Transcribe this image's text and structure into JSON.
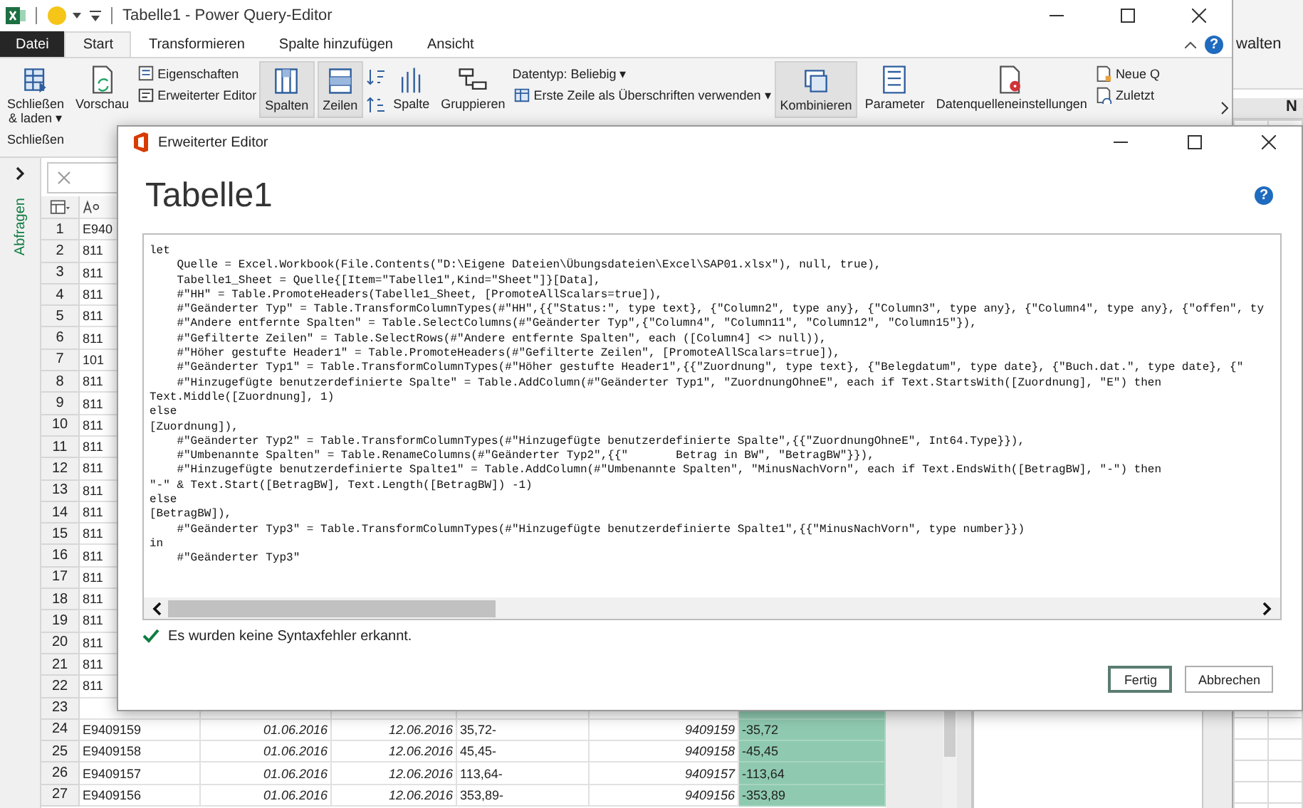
{
  "main_window": {
    "title": "Tabelle1 - Power Query-Editor"
  },
  "ribbon_tabs": [
    {
      "label": "Datei",
      "selected": false,
      "kind": "file"
    },
    {
      "label": "Start",
      "selected": true,
      "kind": "tab"
    },
    {
      "label": "Transformieren",
      "selected": false,
      "kind": "tab"
    },
    {
      "label": "Spalte hinzufügen",
      "selected": false,
      "kind": "tab"
    },
    {
      "label": "Ansicht",
      "selected": false,
      "kind": "tab"
    }
  ],
  "ribbon_help": "?",
  "ribbon": {
    "group_label": "Schließen",
    "items": [
      {
        "kind": "large",
        "lines": [
          "Schließen",
          "& laden ▾"
        ],
        "collapsed": false
      },
      {
        "kind": "large",
        "lines": [
          "Vorschau"
        ],
        "collapsed": false
      },
      {
        "kind": "stack",
        "entries": [
          "Eigenschaften",
          "Erweiterter Editor"
        ]
      },
      {
        "kind": "large",
        "lines": [
          "Spalten"
        ],
        "collapsed": true
      },
      {
        "kind": "large",
        "lines": [
          "Zeilen"
        ],
        "collapsed": true
      },
      {
        "kind": "sort"
      },
      {
        "kind": "large",
        "lines": [
          "Spalte"
        ],
        "collapsed": false
      },
      {
        "kind": "large",
        "lines": [
          "Gruppieren"
        ],
        "collapsed": false
      },
      {
        "kind": "stack",
        "entries": [
          "Datentyp: Beliebig ▾",
          "Erste Zeile als Überschriften verwenden ▾"
        ]
      },
      {
        "kind": "large",
        "lines": [
          "Kombinieren"
        ],
        "collapsed": true
      },
      {
        "kind": "large",
        "lines": [
          "Parameter"
        ],
        "collapsed": false
      },
      {
        "kind": "large",
        "lines": [
          "Datenquelleneinstellungen"
        ],
        "collapsed": false
      },
      {
        "kind": "stack",
        "entries": [
          "Neue Q",
          "Zuletzt"
        ]
      }
    ]
  },
  "sidebar": {
    "label": "Abfragen"
  },
  "table": {
    "columns": [
      {
        "selected": false
      },
      {
        "selected": false
      },
      {
        "selected": false
      },
      {
        "selected": false
      },
      {
        "selected": false
      },
      {
        "selected": true
      }
    ],
    "rows": [
      {
        "number": "1",
        "cells": [
          "E940"
        ]
      },
      {
        "number": "2",
        "cells": [
          "811"
        ]
      },
      {
        "number": "3",
        "cells": [
          "811"
        ]
      },
      {
        "number": "4",
        "cells": [
          "811"
        ]
      },
      {
        "number": "5",
        "cells": [
          "811"
        ]
      },
      {
        "number": "6",
        "cells": [
          "811"
        ]
      },
      {
        "number": "7",
        "cells": [
          "101"
        ]
      },
      {
        "number": "8",
        "cells": [
          "811"
        ]
      },
      {
        "number": "9",
        "cells": [
          "811"
        ]
      },
      {
        "number": "10",
        "cells": [
          "811"
        ]
      },
      {
        "number": "11",
        "cells": [
          "811"
        ]
      },
      {
        "number": "12",
        "cells": [
          "811"
        ]
      },
      {
        "number": "13",
        "cells": [
          "811"
        ]
      },
      {
        "number": "14",
        "cells": [
          "811"
        ]
      },
      {
        "number": "15",
        "cells": [
          "811"
        ]
      },
      {
        "number": "16",
        "cells": [
          "811"
        ]
      },
      {
        "number": "17",
        "cells": [
          "811"
        ]
      },
      {
        "number": "18",
        "cells": [
          "811"
        ]
      },
      {
        "number": "19",
        "cells": [
          "811"
        ]
      },
      {
        "number": "20",
        "cells": [
          "811"
        ]
      },
      {
        "number": "21",
        "cells": [
          "811"
        ]
      },
      {
        "number": "22",
        "cells": [
          "811"
        ]
      },
      {
        "number": "23"
      },
      {
        "number": "24",
        "cells": [
          "E9409159",
          "01.06.2016",
          "12.06.2016",
          "35,72-",
          "9409159",
          "-35,72"
        ]
      },
      {
        "number": "25",
        "cells": [
          "E9409158",
          "01.06.2016",
          "12.06.2016",
          "45,45-",
          "9409158",
          "-45,45"
        ]
      },
      {
        "number": "26",
        "cells": [
          "E9409157",
          "01.06.2016",
          "12.06.2016",
          "113,64-",
          "9409157",
          "-113,64"
        ]
      },
      {
        "number": "27",
        "cells": [
          "E9409156",
          "01.06.2016",
          "12.06.2016",
          "353,89-",
          "9409156",
          "-353,89"
        ]
      }
    ]
  },
  "background_window": {
    "ribbon_text": "walten",
    "column_header": "N"
  },
  "dialog": {
    "title": "Erweiterter Editor",
    "heading": "Tabelle1",
    "help": "?",
    "code": [
      "let",
      "    Quelle = Excel.Workbook(File.Contents(\"D:\\Eigene Dateien\\Übungsdateien\\Excel\\SAP01.xlsx\"), null, true),",
      "    Tabelle1_Sheet = Quelle{[Item=\"Tabelle1\",Kind=\"Sheet\"]}[Data],",
      "    #\"HH\" = Table.PromoteHeaders(Tabelle1_Sheet, [PromoteAllScalars=true]),",
      "    #\"Geänderter Typ\" = Table.TransformColumnTypes(#\"HH\",{{\"Status:\", type text}, {\"Column2\", type any}, {\"Column3\", type any}, {\"Column4\", type any}, {\"offen\", ty",
      "    #\"Andere entfernte Spalten\" = Table.SelectColumns(#\"Geänderter Typ\",{\"Column4\", \"Column11\", \"Column12\", \"Column15\"}),",
      "    #\"Gefilterte Zeilen\" = Table.SelectRows(#\"Andere entfernte Spalten\", each ([Column4] <> null)),",
      "    #\"Höher gestufte Header1\" = Table.PromoteHeaders(#\"Gefilterte Zeilen\", [PromoteAllScalars=true]),",
      "    #\"Geänderter Typ1\" = Table.TransformColumnTypes(#\"Höher gestufte Header1\",{{\"Zuordnung\", type text}, {\"Belegdatum\", type date}, {\"Buch.dat.\", type date}, {\"",
      "    #\"Hinzugefügte benutzerdefinierte Spalte\" = Table.AddColumn(#\"Geänderter Typ1\", \"ZuordnungOhneE\", each if Text.StartsWith([Zuordnung], \"E\") then",
      "Text.Middle([Zuordnung], 1)",
      "else",
      "[Zuordnung]),",
      "    #\"Geänderter Typ2\" = Table.TransformColumnTypes(#\"Hinzugefügte benutzerdefinierte Spalte\",{{\"ZuordnungOhneE\", Int64.Type}}),",
      "    #\"Umbenannte Spalten\" = Table.RenameColumns(#\"Geänderter Typ2\",{{\"       Betrag in BW\", \"BetragBW\"}}),",
      "    #\"Hinzugefügte benutzerdefinierte Spalte1\" = Table.AddColumn(#\"Umbenannte Spalten\", \"MinusNachVorn\", each if Text.EndsWith([BetragBW], \"-\") then",
      "\"-\" & Text.Start([BetragBW], Text.Length([BetragBW]) -1)",
      "else",
      "[BetragBW]),",
      "    #\"Geänderter Typ3\" = Table.TransformColumnTypes(#\"Hinzugefügte benutzerdefinierte Spalte1\",{{\"MinusNachVorn\", type number}})",
      "in",
      "    #\"Geänderter Typ3\""
    ],
    "status": "Es wurden keine Syntaxfehler erkannt.",
    "buttons": [
      {
        "label": "Fertig",
        "default": true
      },
      {
        "label": "Abbrechen",
        "default": false
      }
    ]
  }
}
